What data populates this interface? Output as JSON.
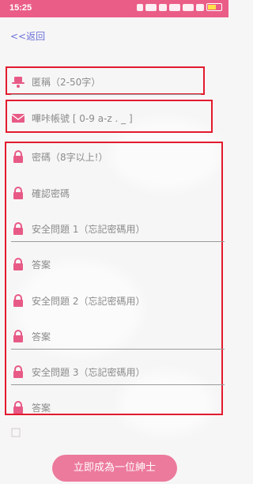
{
  "status": {
    "time": "15:25",
    "battery_color": "#ffe14a"
  },
  "nav": {
    "back_label": "<<返回"
  },
  "form": {
    "nickname_placeholder": "匿稱（2-50字）",
    "account_placeholder": "嗶咔帳號 [ 0-9 a-z . _ ]",
    "password_placeholder": "密碼（8字以上!）",
    "confirm_password_placeholder": "確認密碼",
    "question1_placeholder": "安全問題 1（忘記密碼用）",
    "answer1_placeholder": "答案",
    "question2_placeholder": "安全問題 2（忘記密碼用）",
    "answer2_placeholder": "答案",
    "question3_placeholder": "安全問題 3（忘記密碼用）",
    "answer3_placeholder": "答案"
  },
  "submit": {
    "label": "立即成為一位紳士"
  },
  "colors": {
    "accent": "#ea5d87",
    "button": "#ec7a9c",
    "link": "#6a72d8",
    "highlight_box": "#e31b2e"
  },
  "icons": {
    "nickname": "gentleman-hat-icon",
    "account": "envelope-icon",
    "password": "lock-icon"
  }
}
